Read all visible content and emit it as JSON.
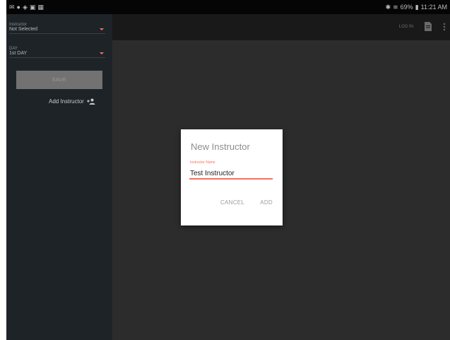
{
  "status_bar": {
    "left_icons": [
      "mail-icon",
      "notification-icon",
      "cast-icon",
      "image-icon",
      "calendar-icon"
    ],
    "right_text": "69%",
    "time": "11:21 AM"
  },
  "sidebar": {
    "instructor_label": "Instructor",
    "instructor_value": "Not Selected",
    "day_label": "DAY",
    "day_value": "1st DAY",
    "save_label": "SAVE",
    "add_instructor_label": "Add Instructor"
  },
  "toolbar": {
    "text": "LOG IN"
  },
  "dialog": {
    "title": "New Instructor",
    "field_label": "Instructor Name",
    "input_value": "Test Instructor",
    "cancel_label": "CANCEL",
    "add_label": "ADD"
  },
  "colors": {
    "accent": "#ff6e5a",
    "sidebar_bg": "#1e2328",
    "content_bg": "#2c2c2c",
    "toolbar_bg": "#191919"
  }
}
